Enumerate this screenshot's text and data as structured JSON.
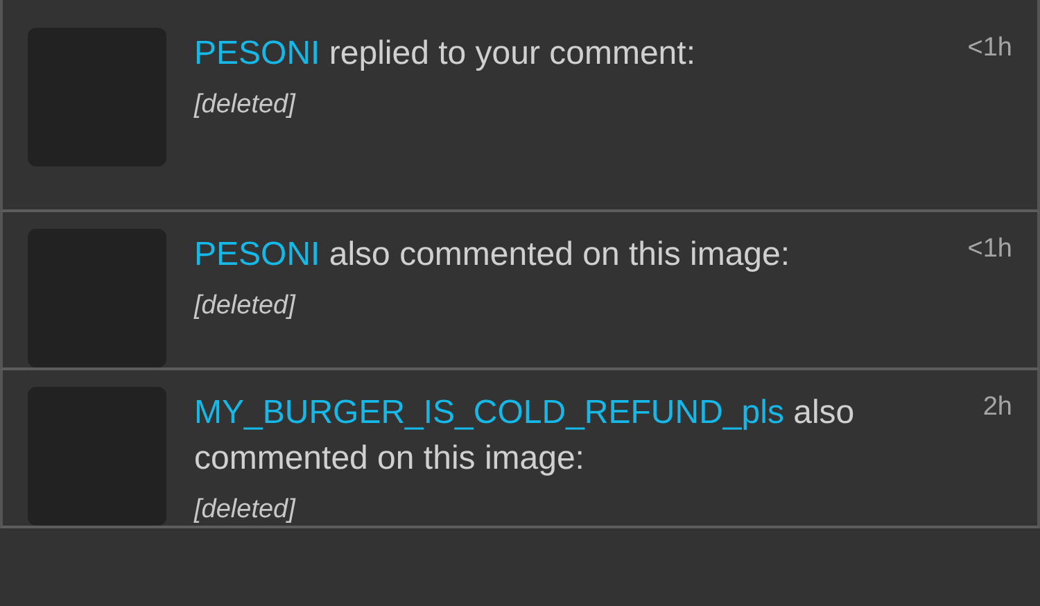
{
  "notifications": [
    {
      "user": "PESONI",
      "action": "replied to your comment:",
      "comment": "[deleted]",
      "time": "<1h"
    },
    {
      "user": "PESONI",
      "action": "also commented on this image:",
      "comment": "[deleted]",
      "time": "<1h"
    },
    {
      "user": "MY_BURGER_IS_COLD_REFUND_pls",
      "action": "also commented on this image:",
      "comment": "[deleted]",
      "time": "2h"
    }
  ]
}
